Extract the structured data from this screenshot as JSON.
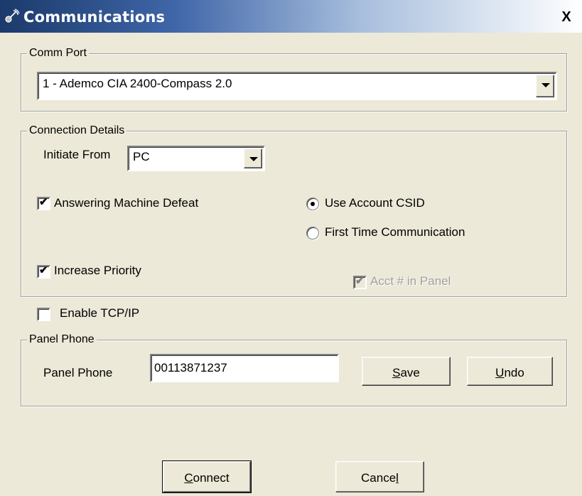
{
  "window": {
    "title": "Communications",
    "icon": "satellite-dish-icon",
    "close_label": "X"
  },
  "comm_port": {
    "legend": "Comm Port",
    "selected": "1 - Ademco CIA 2400-Compass 2.0"
  },
  "connection_details": {
    "legend": "Connection Details",
    "initiate_from_label": "Initiate From",
    "initiate_from_value": "PC",
    "answering_machine_defeat": {
      "label": "Answering Machine Defeat",
      "checked": true
    },
    "increase_priority": {
      "label": "Increase Priority",
      "checked": true
    },
    "use_account_csid": {
      "label": "Use Account CSID",
      "selected": true
    },
    "first_time_communication": {
      "label": "First Time Communication",
      "selected": false
    },
    "acct_in_panel": {
      "label": "Acct # in Panel",
      "checked": true,
      "enabled": false
    }
  },
  "enable_tcpip": {
    "label": "Enable TCP/IP",
    "checked": false
  },
  "panel_phone": {
    "legend": "Panel Phone",
    "label": "Panel Phone",
    "value": "00113871237",
    "save_label_pre": "",
    "save_label_accel": "S",
    "save_label_post": "ave",
    "undo_label_pre": "",
    "undo_label_accel": "U",
    "undo_label_post": "ndo"
  },
  "buttons": {
    "connect_pre": "",
    "connect_accel": "C",
    "connect_post": "onnect",
    "cancel_pre": "Cance",
    "cancel_accel": "l",
    "cancel_post": ""
  }
}
